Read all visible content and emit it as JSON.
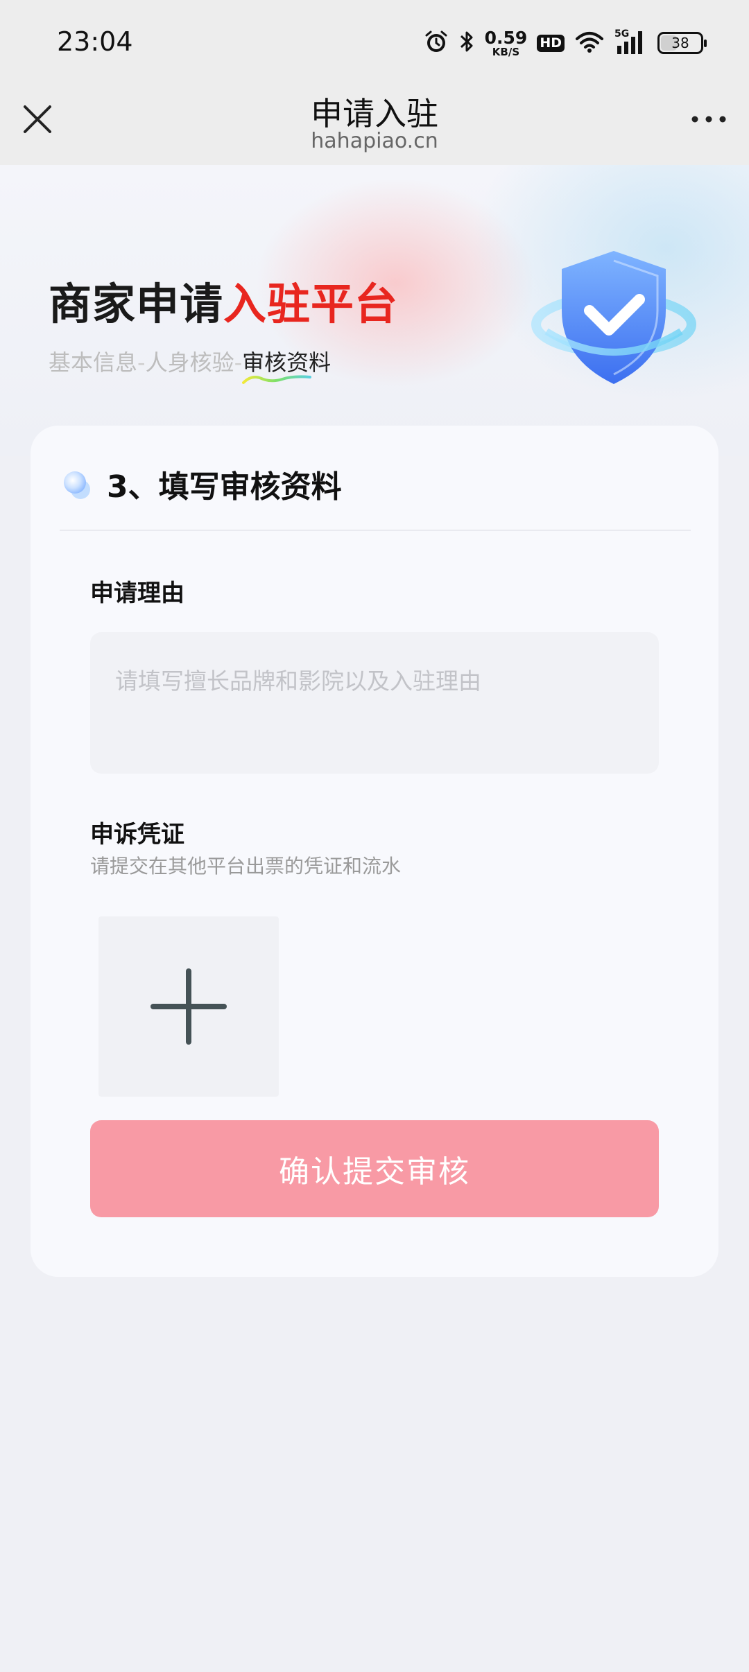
{
  "status_bar": {
    "time": "23:04",
    "net_speed_value": "0.59",
    "net_speed_unit": "KB/S",
    "hd_badge": "HD",
    "network_type": "5G",
    "battery": "38"
  },
  "nav": {
    "title": "申请入驻",
    "subtitle": "hahapiao.cn"
  },
  "hero": {
    "title_part1": "商家申请",
    "title_part2": "入驻平台",
    "steps": [
      "基本信息",
      "人身核验",
      "审核资料"
    ],
    "step_separator": "-",
    "active_step_index": 2
  },
  "form": {
    "section_title": "3、填写审核资料",
    "reason_label": "申请理由",
    "reason_placeholder": "请填写擅长品牌和影院以及入驻理由",
    "reason_value": "",
    "proof_label": "申诉凭证",
    "proof_hint": "请提交在其他平台出票的凭证和流水",
    "submit_label": "确认提交审核"
  },
  "colors": {
    "accent_red": "#e8261f",
    "submit_bg": "#f89aa5",
    "page_bg": "#eff0f5"
  },
  "icons": [
    "alarm-icon",
    "bluetooth-icon",
    "wifi-icon",
    "signal-icon",
    "battery-icon",
    "close-icon",
    "more-icon",
    "shield-check-icon",
    "plus-icon"
  ]
}
